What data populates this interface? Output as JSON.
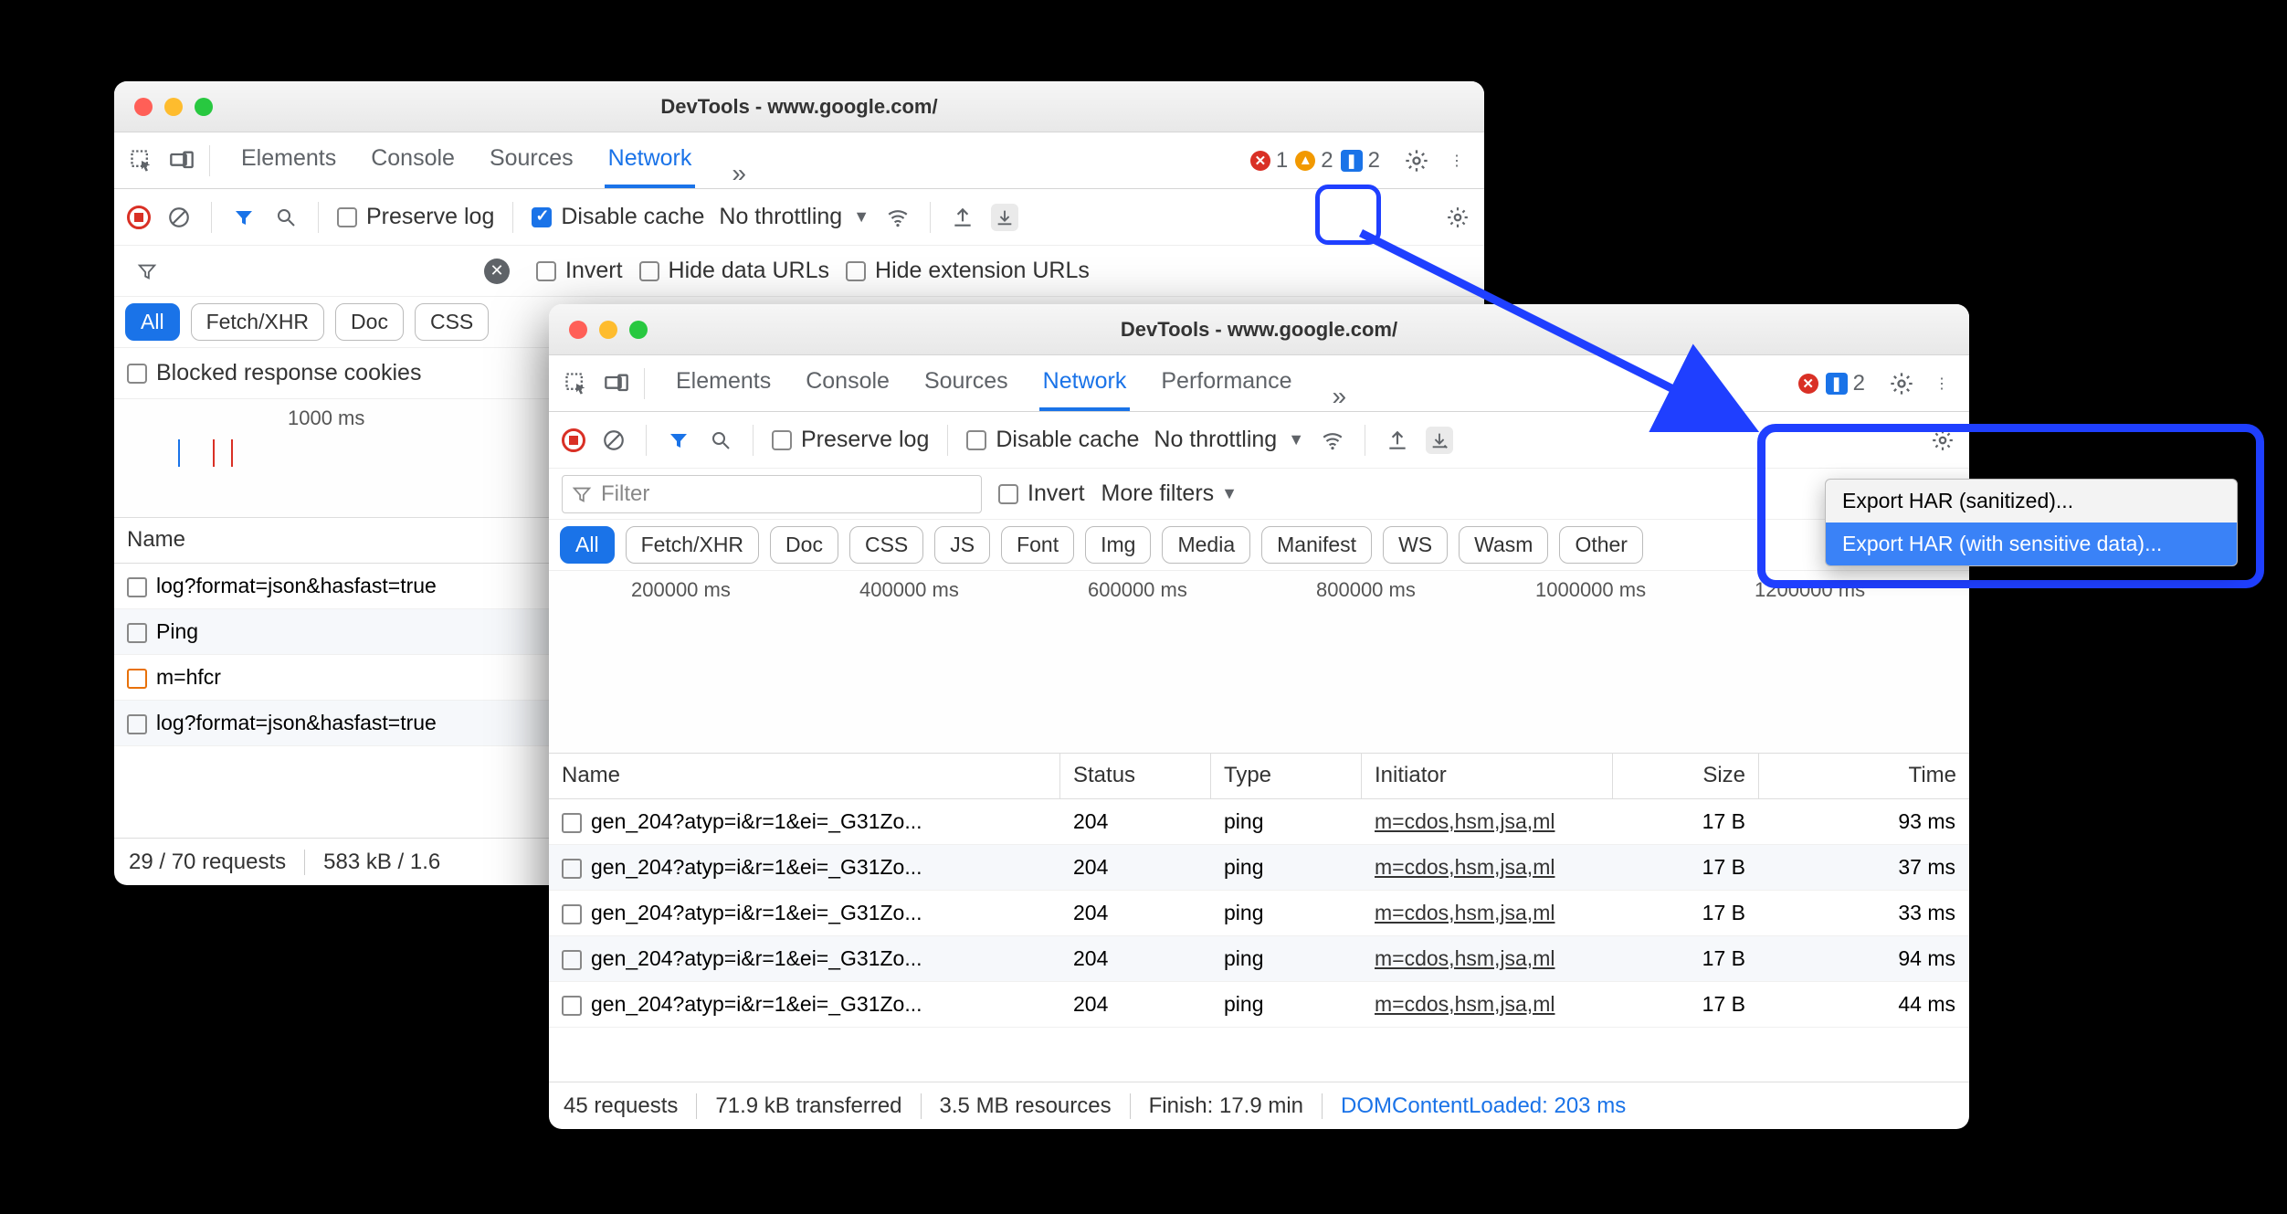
{
  "windowTitle": "DevTools - www.google.com/",
  "tabs": {
    "elements": "Elements",
    "console": "Console",
    "sources": "Sources",
    "network": "Network",
    "performance": "Performance"
  },
  "badges": {
    "errors": "1",
    "warnings": "2",
    "info": "2"
  },
  "netbar": {
    "preserve": "Preserve log",
    "disableCache": "Disable cache",
    "throttling": "No throttling"
  },
  "filterbar": {
    "placeholder": "Filter",
    "invert": "Invert",
    "hideData": "Hide data URLs",
    "hideExt": "Hide extension URLs",
    "moreFilters": "More filters"
  },
  "pills": {
    "all": "All",
    "fx": "Fetch/XHR",
    "doc": "Doc",
    "css": "CSS",
    "js": "JS",
    "font": "Font",
    "img": "Img",
    "media": "Media",
    "manifest": "Manifest",
    "ws": "WS",
    "wasm": "Wasm",
    "other": "Other"
  },
  "win1": {
    "blockedCookies": "Blocked response cookies",
    "timeline": {
      "t1": "1000 ms"
    },
    "nameHeader": "Name",
    "rows": [
      "log?format=json&hasfast=true",
      "Ping",
      "m=hfcr",
      "log?format=json&hasfast=true"
    ],
    "status": {
      "req": "29 / 70 requests",
      "tx": "583 kB / 1.6"
    }
  },
  "win2": {
    "timeline": {
      "t1": "200000 ms",
      "t2": "400000 ms",
      "t3": "600000 ms",
      "t4": "800000 ms",
      "t5": "1000000 ms",
      "t6": "1200000 ms"
    },
    "cols": {
      "name": "Name",
      "status": "Status",
      "type": "Type",
      "initiator": "Initiator",
      "size": "Size",
      "time": "Time"
    },
    "rows": [
      {
        "name": "gen_204?atyp=i&r=1&ei=_G31Zo...",
        "status": "204",
        "type": "ping",
        "initiator": "m=cdos,hsm,jsa,ml",
        "size": "17 B",
        "time": "93 ms"
      },
      {
        "name": "gen_204?atyp=i&r=1&ei=_G31Zo...",
        "status": "204",
        "type": "ping",
        "initiator": "m=cdos,hsm,jsa,ml",
        "size": "17 B",
        "time": "37 ms"
      },
      {
        "name": "gen_204?atyp=i&r=1&ei=_G31Zo...",
        "status": "204",
        "type": "ping",
        "initiator": "m=cdos,hsm,jsa,ml",
        "size": "17 B",
        "time": "33 ms"
      },
      {
        "name": "gen_204?atyp=i&r=1&ei=_G31Zo...",
        "status": "204",
        "type": "ping",
        "initiator": "m=cdos,hsm,jsa,ml",
        "size": "17 B",
        "time": "94 ms"
      },
      {
        "name": "gen_204?atyp=i&r=1&ei=_G31Zo...",
        "status": "204",
        "type": "ping",
        "initiator": "m=cdos,hsm,jsa,ml",
        "size": "17 B",
        "time": "44 ms"
      }
    ],
    "status": {
      "req": "45 requests",
      "tx": "71.9 kB transferred",
      "res": "3.5 MB resources",
      "finish": "Finish: 17.9 min",
      "dcl": "DOMContentLoaded: 203 ms"
    }
  },
  "dropdown": {
    "sanitized": "Export HAR (sanitized)...",
    "sensitive": "Export HAR (with sensitive data)..."
  }
}
